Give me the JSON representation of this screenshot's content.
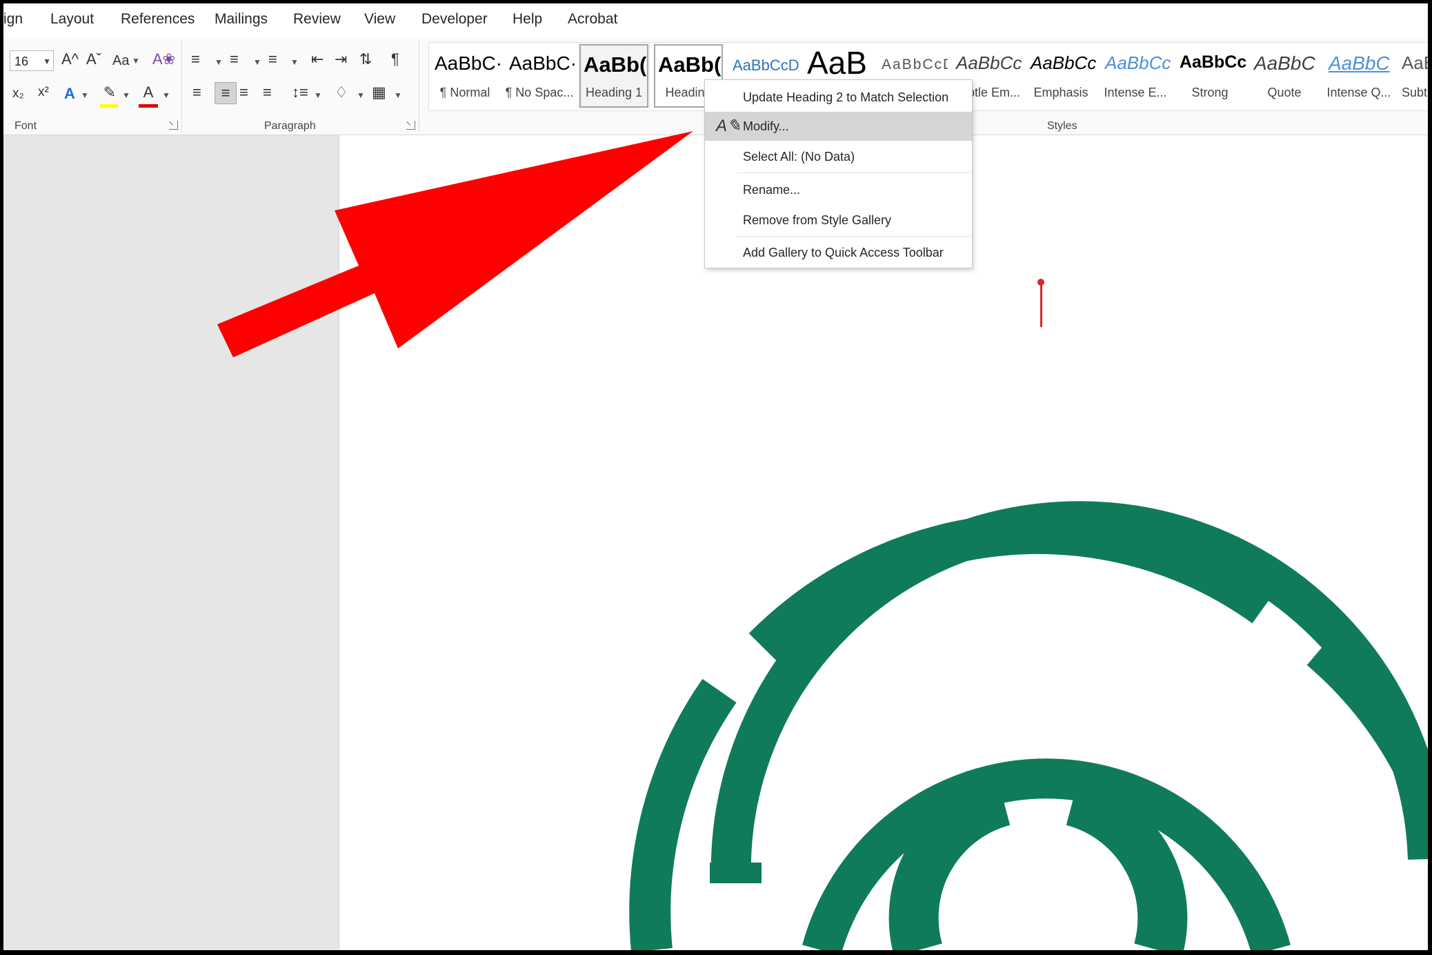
{
  "tabs": [
    "ign",
    "Layout",
    "References",
    "Mailings",
    "Review",
    "View",
    "Developer",
    "Help",
    "Acrobat"
  ],
  "font": {
    "size": "16",
    "group_label": "Font",
    "grow_label": "A^",
    "shrink_label": "Aˇ",
    "case_label": "Aa",
    "subscript": "x₂",
    "superscript": "x²",
    "text_effects": "A",
    "font_color": "A"
  },
  "paragraph": {
    "group_label": "Paragraph",
    "pilcrow": "¶"
  },
  "styles": {
    "group_label": "Styles",
    "items": [
      {
        "sample": "AaBbC·",
        "name": "¶ Normal"
      },
      {
        "sample": "AaBbC·",
        "name": "¶ No Spac..."
      },
      {
        "sample": "AaBb(",
        "name": "Heading 1"
      },
      {
        "sample": "AaBb(",
        "name": "Heading"
      },
      {
        "sample": "AaBbCcDı",
        "name": ""
      },
      {
        "sample": "AaB",
        "name": ""
      },
      {
        "sample": "AaBbCcD",
        "name": ""
      },
      {
        "sample": "AaBbCcI",
        "name": "Subtle Em..."
      },
      {
        "sample": "AaBbCcI",
        "name": "Emphasis"
      },
      {
        "sample": "AaBbCcI",
        "name": "Intense E..."
      },
      {
        "sample": "AaBbCc",
        "name": "Strong"
      },
      {
        "sample": "AaBbC",
        "name": "Quote"
      },
      {
        "sample": "AaBbC",
        "name": "Intense Q..."
      },
      {
        "sample": "AaB",
        "name": "Subtl"
      }
    ]
  },
  "context_menu": {
    "items": [
      {
        "label": "Update Heading 2 to Match Selection"
      },
      {
        "label": "Modify..."
      },
      {
        "label": "Select All: (No Data)"
      },
      {
        "label": "Rename..."
      },
      {
        "label": "Remove from Style Gallery"
      },
      {
        "label": "Add Gallery to Quick Access Toolbar"
      }
    ]
  },
  "colors": {
    "annotation_arrow": "#ff0000",
    "logo_green": "#0f7b5a",
    "highlight_yellow": "#ffff00",
    "font_color_red": "#e00000",
    "cursor_red": "#d9262b"
  }
}
